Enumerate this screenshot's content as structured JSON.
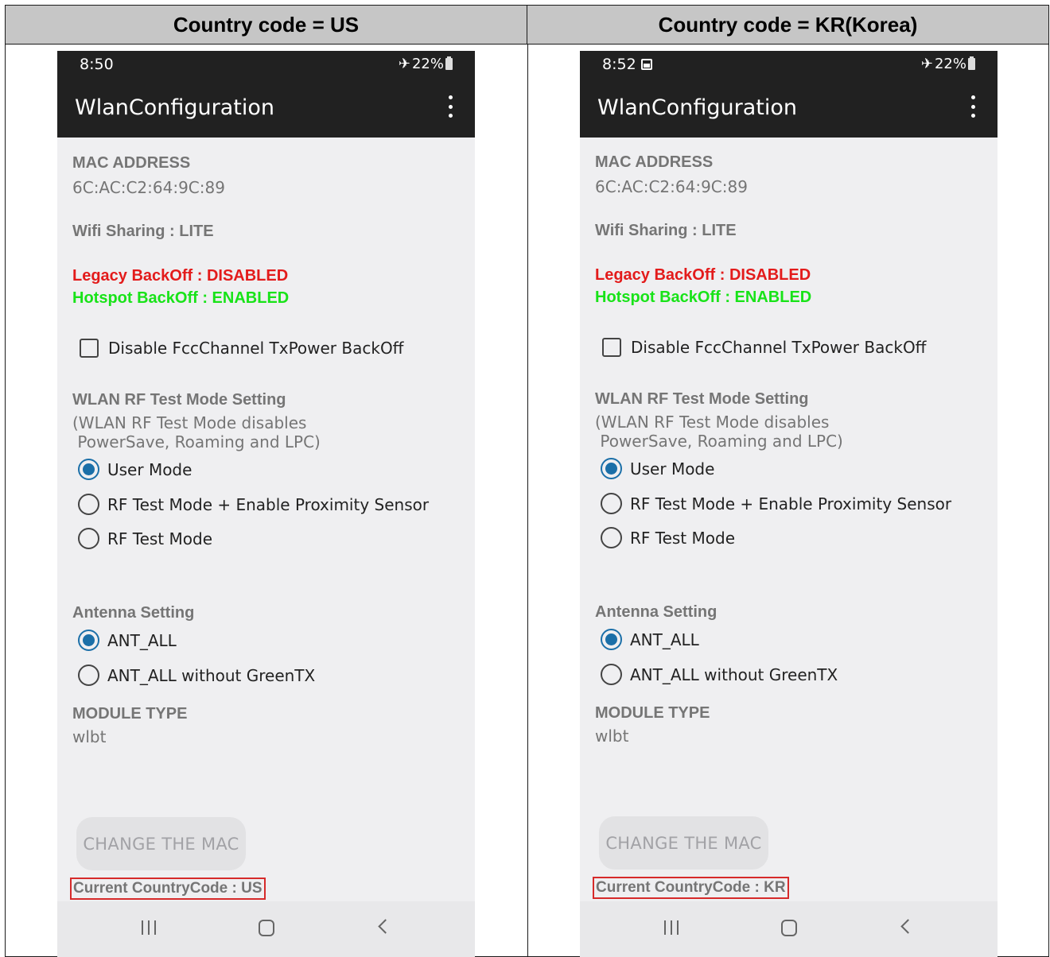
{
  "headers": {
    "left": "Country code = US",
    "right": "Country code = KR(Korea)"
  },
  "screens": [
    {
      "time": "8:50",
      "battery": "22%",
      "app_title": "WlanConfiguration",
      "mac_label": "MAC ADDRESS",
      "mac_value": "6C:AC:C2:64:9C:89",
      "wifi_sharing": "Wifi Sharing : LITE",
      "legacy_backoff": "Legacy BackOff : DISABLED",
      "hotspot_backoff": "Hotspot BackOff : ENABLED",
      "checkbox_label": "Disable FccChannel TxPower BackOff",
      "rf_title": "WLAN RF Test Mode Setting",
      "rf_desc1": "(WLAN RF Test Mode disables",
      "rf_desc2": " PowerSave, Roaming and LPC)",
      "rf_options": [
        "User Mode",
        "RF Test Mode + Enable Proximity Sensor",
        "RF Test Mode"
      ],
      "rf_selected": 0,
      "antenna_title": "Antenna Setting",
      "antenna_options": [
        "ANT_ALL",
        "ANT_ALL without GreenTX"
      ],
      "antenna_selected": 0,
      "module_label": "MODULE TYPE",
      "module_value": "wlbt",
      "change_button": "CHANGE THE MAC",
      "country_code": "Current CountryCode : US"
    },
    {
      "time": "8:52",
      "battery": "22%",
      "app_title": "WlanConfiguration",
      "mac_label": "MAC ADDRESS",
      "mac_value": "6C:AC:C2:64:9C:89",
      "wifi_sharing": "Wifi Sharing : LITE",
      "legacy_backoff": "Legacy BackOff : DISABLED",
      "hotspot_backoff": "Hotspot BackOff : ENABLED",
      "checkbox_label": "Disable FccChannel TxPower BackOff",
      "rf_title": "WLAN RF Test Mode Setting",
      "rf_desc1": "(WLAN RF Test Mode disables",
      "rf_desc2": " PowerSave, Roaming and LPC)",
      "rf_options": [
        "User Mode",
        "RF Test Mode + Enable Proximity Sensor",
        "RF Test Mode"
      ],
      "rf_selected": 0,
      "antenna_title": "Antenna Setting",
      "antenna_options": [
        "ANT_ALL",
        "ANT_ALL without GreenTX"
      ],
      "antenna_selected": 0,
      "module_label": "MODULE TYPE",
      "module_value": "wlbt",
      "change_button": "CHANGE THE MAC",
      "country_code": "Current CountryCode : KR"
    }
  ],
  "icons": {
    "airplane": "airplane-mode-icon",
    "battery": "battery-icon",
    "overflow": "more-options-icon",
    "image": "image-notification-icon",
    "recents": "recents-icon",
    "home": "home-icon",
    "back": "back-icon"
  },
  "colors": {
    "appbar": "#212121",
    "background": "#efeff1",
    "disabled_red": "#e31b1b",
    "enabled_green": "#18e318",
    "radio_accent": "#1b6fa8",
    "highlight_box": "#d62a2a"
  }
}
